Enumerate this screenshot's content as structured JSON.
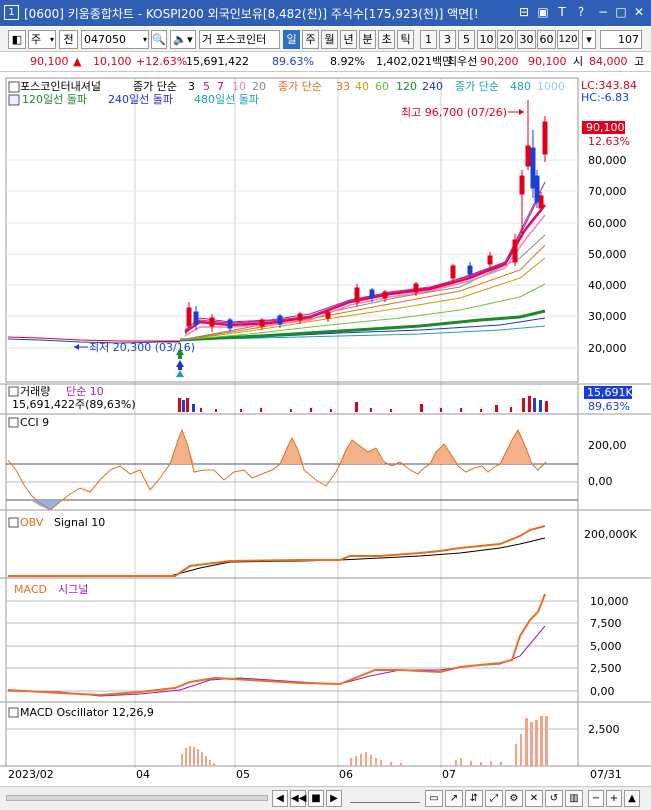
{
  "window": {
    "number": "1",
    "title": "[0600] 키움종합차트 - KOSPI200 외국인보유[8,482(천)] 주식수[175,923(천)] 액면[!",
    "buttons": [
      "⊟",
      "▣",
      "T",
      "?",
      "−",
      "□",
      "✕"
    ]
  },
  "toolbar": {
    "market": "주",
    "prev": "전",
    "code": "047050",
    "name": "포스코인터",
    "name_prefix": "거",
    "periods": [
      "일",
      "주",
      "월",
      "년",
      "분",
      "초",
      "틱"
    ],
    "active_period": "일",
    "intervals": [
      "1",
      "3",
      "5",
      "10",
      "20",
      "30",
      "60",
      "120"
    ],
    "count": "107"
  },
  "pricebar": {
    "price": "90,100",
    "change": "10,100",
    "change_rate": "+12.63%",
    "volume": "15,691,422",
    "volume_ratio": "89.63%",
    "turnover": "8.92%",
    "amount": "1,402,021백만",
    "best_ask_label": "최우선",
    "best_ask": "90,200",
    "best_bid": "90,100",
    "open_label": "시",
    "open": "84,000",
    "high_label": "고"
  },
  "price_panel": {
    "legend_name": "포스코인터내셔널",
    "legend_price_ma": "종가 단순",
    "ma_periods": [
      "3",
      "5",
      "7",
      "10",
      "20"
    ],
    "legend_price_ma2": "종가 단순",
    "ma_periods2": [
      "33",
      "40",
      "60",
      "120",
      "240"
    ],
    "legend_price_ma3": "종가 단순",
    "ma_periods3": [
      "480",
      "1000"
    ],
    "breakouts": [
      "120일선 돌파",
      "240일선 돌파",
      "480일선 돌파"
    ],
    "lc": "LC:343.84",
    "hc": "HC:-6.83",
    "high_note": "최고 96,700 (07/26)",
    "low_note": "최저 20,300 (03/16)",
    "current_price": "90,100",
    "current_rate": "12.63%",
    "axis_ticks": [
      "80,000",
      "70,000",
      "60,000",
      "50,000",
      "40,000",
      "30,000",
      "20,000"
    ]
  },
  "volume_panel": {
    "title": "거래량",
    "ma_label": "단순 10",
    "value": "15,691,422주(89,63%)",
    "badge_value": "15,691K",
    "badge_rate": "89,63%"
  },
  "cci_panel": {
    "title": "CCI 9",
    "axis_ticks": [
      "200,00",
      "0,00"
    ]
  },
  "obv_panel": {
    "title": "OBV",
    "signal": "Signal 10",
    "axis_ticks": [
      "200,000K"
    ]
  },
  "macd_panel": {
    "title": "MACD",
    "signal": "시그널",
    "axis_ticks": [
      "10,000",
      "7,500",
      "5,000",
      "2,500",
      "0,00"
    ]
  },
  "osc_panel": {
    "title": "MACD Oscillator 12,26,9",
    "axis_ticks": [
      "2,500"
    ]
  },
  "x_axis": {
    "labels": [
      "2023/02",
      "04",
      "05",
      "06",
      "07"
    ],
    "last_date": "07/31"
  },
  "colors": {
    "up": "#e0001a",
    "down": "#1a3fd6",
    "title_bar": "#2f5fb4",
    "obv_line": "#e8702a",
    "macd_line": "#e8702a",
    "signal_line": "#8a1fb0",
    "cci_fill": "#f3b08a",
    "osc_bar": "#f0a58a"
  }
}
